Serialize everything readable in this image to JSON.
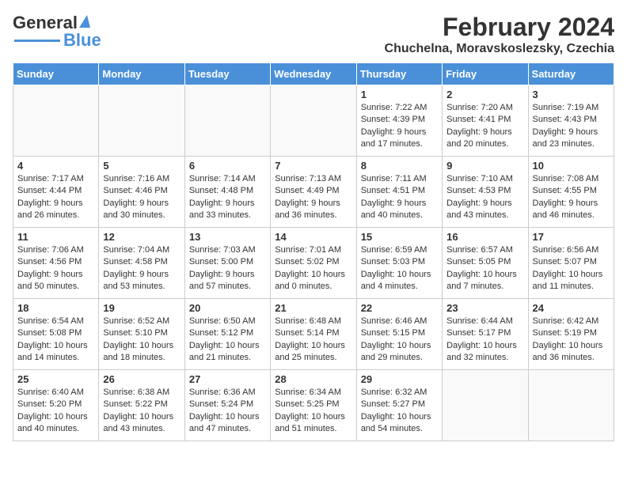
{
  "header": {
    "logo_general": "General",
    "logo_blue": "Blue",
    "month_year": "February 2024",
    "location": "Chuchelna, Moravskoslezsky, Czechia"
  },
  "weekdays": [
    "Sunday",
    "Monday",
    "Tuesday",
    "Wednesday",
    "Thursday",
    "Friday",
    "Saturday"
  ],
  "weeks": [
    [
      {
        "day": "",
        "info": ""
      },
      {
        "day": "",
        "info": ""
      },
      {
        "day": "",
        "info": ""
      },
      {
        "day": "",
        "info": ""
      },
      {
        "day": "1",
        "info": "Sunrise: 7:22 AM\nSunset: 4:39 PM\nDaylight: 9 hours\nand 17 minutes."
      },
      {
        "day": "2",
        "info": "Sunrise: 7:20 AM\nSunset: 4:41 PM\nDaylight: 9 hours\nand 20 minutes."
      },
      {
        "day": "3",
        "info": "Sunrise: 7:19 AM\nSunset: 4:43 PM\nDaylight: 9 hours\nand 23 minutes."
      }
    ],
    [
      {
        "day": "4",
        "info": "Sunrise: 7:17 AM\nSunset: 4:44 PM\nDaylight: 9 hours\nand 26 minutes."
      },
      {
        "day": "5",
        "info": "Sunrise: 7:16 AM\nSunset: 4:46 PM\nDaylight: 9 hours\nand 30 minutes."
      },
      {
        "day": "6",
        "info": "Sunrise: 7:14 AM\nSunset: 4:48 PM\nDaylight: 9 hours\nand 33 minutes."
      },
      {
        "day": "7",
        "info": "Sunrise: 7:13 AM\nSunset: 4:49 PM\nDaylight: 9 hours\nand 36 minutes."
      },
      {
        "day": "8",
        "info": "Sunrise: 7:11 AM\nSunset: 4:51 PM\nDaylight: 9 hours\nand 40 minutes."
      },
      {
        "day": "9",
        "info": "Sunrise: 7:10 AM\nSunset: 4:53 PM\nDaylight: 9 hours\nand 43 minutes."
      },
      {
        "day": "10",
        "info": "Sunrise: 7:08 AM\nSunset: 4:55 PM\nDaylight: 9 hours\nand 46 minutes."
      }
    ],
    [
      {
        "day": "11",
        "info": "Sunrise: 7:06 AM\nSunset: 4:56 PM\nDaylight: 9 hours\nand 50 minutes."
      },
      {
        "day": "12",
        "info": "Sunrise: 7:04 AM\nSunset: 4:58 PM\nDaylight: 9 hours\nand 53 minutes."
      },
      {
        "day": "13",
        "info": "Sunrise: 7:03 AM\nSunset: 5:00 PM\nDaylight: 9 hours\nand 57 minutes."
      },
      {
        "day": "14",
        "info": "Sunrise: 7:01 AM\nSunset: 5:02 PM\nDaylight: 10 hours\nand 0 minutes."
      },
      {
        "day": "15",
        "info": "Sunrise: 6:59 AM\nSunset: 5:03 PM\nDaylight: 10 hours\nand 4 minutes."
      },
      {
        "day": "16",
        "info": "Sunrise: 6:57 AM\nSunset: 5:05 PM\nDaylight: 10 hours\nand 7 minutes."
      },
      {
        "day": "17",
        "info": "Sunrise: 6:56 AM\nSunset: 5:07 PM\nDaylight: 10 hours\nand 11 minutes."
      }
    ],
    [
      {
        "day": "18",
        "info": "Sunrise: 6:54 AM\nSunset: 5:08 PM\nDaylight: 10 hours\nand 14 minutes."
      },
      {
        "day": "19",
        "info": "Sunrise: 6:52 AM\nSunset: 5:10 PM\nDaylight: 10 hours\nand 18 minutes."
      },
      {
        "day": "20",
        "info": "Sunrise: 6:50 AM\nSunset: 5:12 PM\nDaylight: 10 hours\nand 21 minutes."
      },
      {
        "day": "21",
        "info": "Sunrise: 6:48 AM\nSunset: 5:14 PM\nDaylight: 10 hours\nand 25 minutes."
      },
      {
        "day": "22",
        "info": "Sunrise: 6:46 AM\nSunset: 5:15 PM\nDaylight: 10 hours\nand 29 minutes."
      },
      {
        "day": "23",
        "info": "Sunrise: 6:44 AM\nSunset: 5:17 PM\nDaylight: 10 hours\nand 32 minutes."
      },
      {
        "day": "24",
        "info": "Sunrise: 6:42 AM\nSunset: 5:19 PM\nDaylight: 10 hours\nand 36 minutes."
      }
    ],
    [
      {
        "day": "25",
        "info": "Sunrise: 6:40 AM\nSunset: 5:20 PM\nDaylight: 10 hours\nand 40 minutes."
      },
      {
        "day": "26",
        "info": "Sunrise: 6:38 AM\nSunset: 5:22 PM\nDaylight: 10 hours\nand 43 minutes."
      },
      {
        "day": "27",
        "info": "Sunrise: 6:36 AM\nSunset: 5:24 PM\nDaylight: 10 hours\nand 47 minutes."
      },
      {
        "day": "28",
        "info": "Sunrise: 6:34 AM\nSunset: 5:25 PM\nDaylight: 10 hours\nand 51 minutes."
      },
      {
        "day": "29",
        "info": "Sunrise: 6:32 AM\nSunset: 5:27 PM\nDaylight: 10 hours\nand 54 minutes."
      },
      {
        "day": "",
        "info": ""
      },
      {
        "day": "",
        "info": ""
      }
    ]
  ]
}
